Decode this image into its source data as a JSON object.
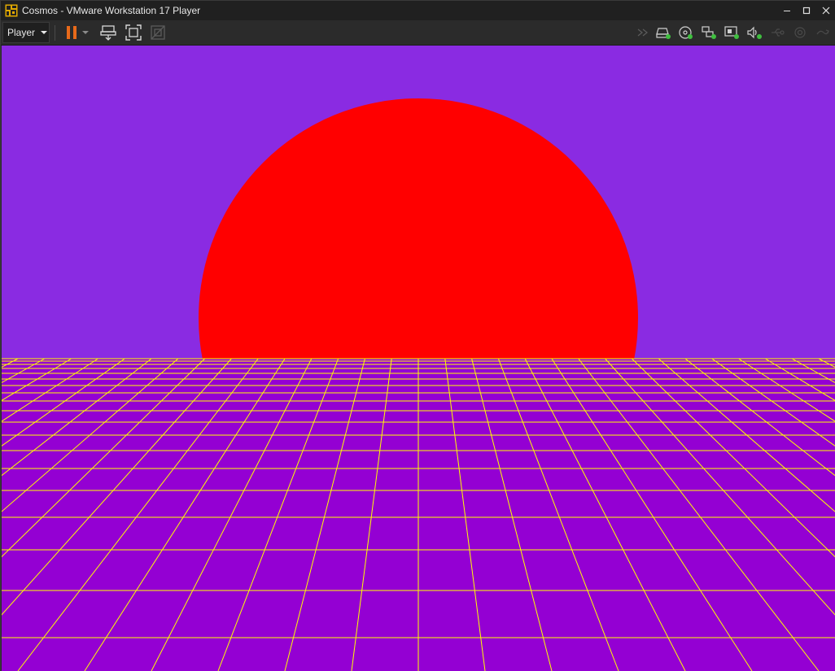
{
  "window": {
    "title": "Cosmos - VMware Workstation 17 Player",
    "icon": "vmware-player-icon",
    "controls": [
      "minimize-icon",
      "maximize-icon",
      "close-icon"
    ]
  },
  "toolbar": {
    "player_menu_label": "Player",
    "left_buttons": [
      "pause-icon",
      "dropdown-arrow-icon",
      "send-ctrl-alt-del-icon",
      "full-screen-icon",
      "unity-icon"
    ],
    "device_icons": [
      "forward-icon",
      "hard-disk-icon",
      "cd-dvd-icon",
      "network-adapter-icon",
      "display-icon",
      "sound-card-icon",
      "usb-icon",
      "camera-icon",
      "more-devices-icon"
    ]
  },
  "vm_display": {
    "sky_color": "#8a2be2",
    "sun_color": "#ff0000",
    "ground_color": "#9400d3",
    "grid_color": "#ffff00"
  }
}
